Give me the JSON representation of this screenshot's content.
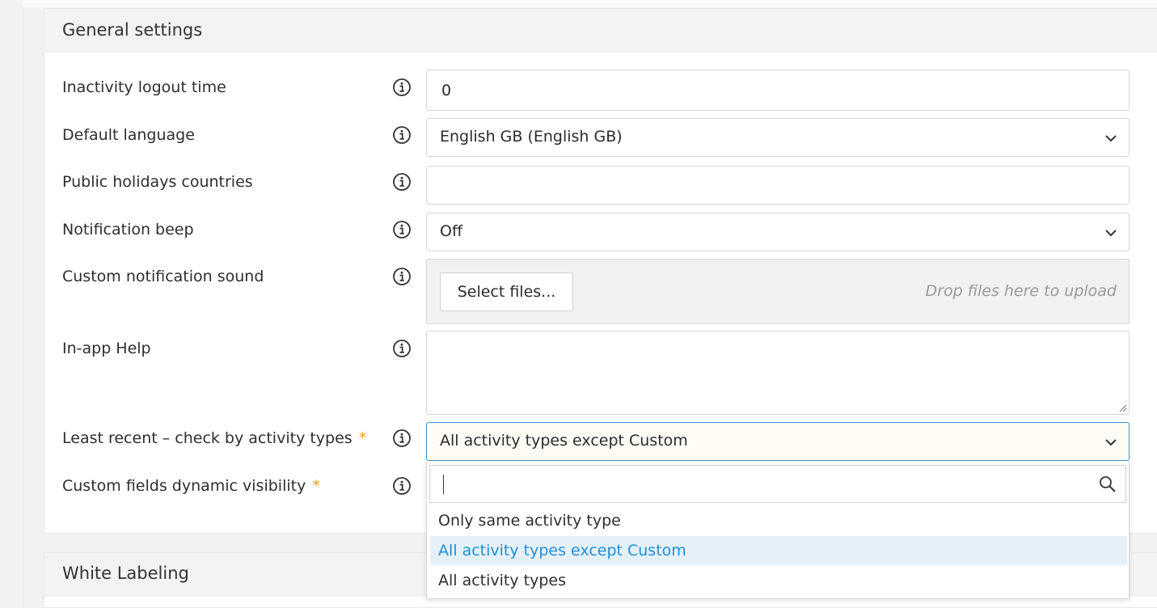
{
  "sections": {
    "general": {
      "title": "General settings"
    },
    "white_labeling": {
      "title": "White Labeling"
    }
  },
  "fields": {
    "inactivity": {
      "label": "Inactivity logout time",
      "value": "0"
    },
    "language": {
      "label": "Default language",
      "value": "English GB (English GB)"
    },
    "holidays": {
      "label": "Public holidays countries",
      "value": ""
    },
    "beep": {
      "label": "Notification beep",
      "value": "Off"
    },
    "sound": {
      "label": "Custom notification sound",
      "button": "Select files...",
      "drop_hint": "Drop files here to upload"
    },
    "help": {
      "label": "In-app Help",
      "value": ""
    },
    "least_recent": {
      "label": "Least recent – check by activity types",
      "required": "*",
      "value": "All activity types except Custom"
    },
    "custom_fields": {
      "label": "Custom fields dynamic visibility",
      "required": "*"
    }
  },
  "dropdown": {
    "search_value": "",
    "options": [
      "Only same activity type",
      "All activity types except Custom",
      "All activity types"
    ],
    "selected_index": 1
  },
  "icons": {
    "info": "info-circle-icon",
    "chevron": "chevron-down-icon",
    "search": "search-icon",
    "resize": "resize-handle-icon"
  },
  "colors": {
    "accent": "#1f8fd6",
    "selected_bg": "#e5f1fa",
    "required": "#f0a020",
    "focus_border": "#3a96d0"
  }
}
